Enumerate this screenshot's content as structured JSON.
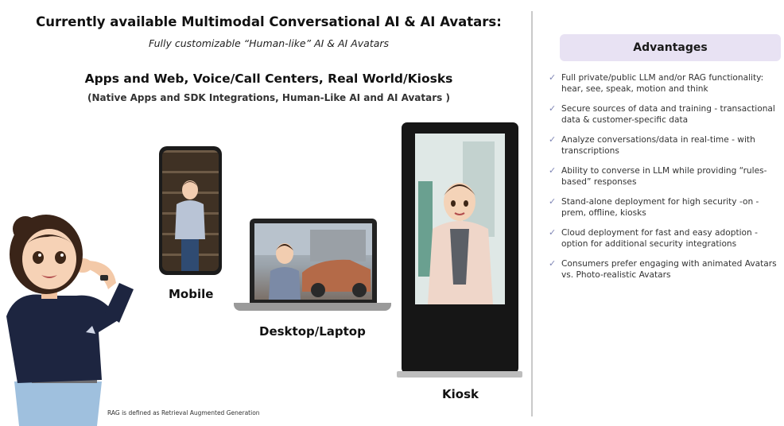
{
  "header": {
    "title": "Currently available Multimodal Conversational AI & AI Avatars:",
    "subtitle": "Fully customizable “Human-like” AI & AI Avatars",
    "apps_title": "Apps and Web, Voice/Call Centers, Real World/Kiosks",
    "apps_subtitle": "(Native Apps and SDK Integrations, Human-Like AI and AI Avatars )"
  },
  "devices": {
    "mobile_label": "Mobile",
    "desktop_label": "Desktop/Laptop",
    "kiosk_label": "Kiosk"
  },
  "footnote": "RAG is defined as Retrieval Augmented Generation",
  "advantages": {
    "title": "Advantages",
    "check_icon": "✓",
    "items": [
      "Full private/public LLM and/or RAG functionality: hear, see, speak, motion and think",
      "Secure sources of data and training - transactional data & customer-specific data",
      "Analyze conversations/data in real-time - with transcriptions",
      "Ability to converse in LLM while providing “rules-based” responses",
      "Stand-alone deployment for high security -on -prem, offline, kiosks",
      "Cloud deployment for fast and easy adoption - option for additional security integrations",
      "Consumers prefer engaging with animated Avatars vs. Photo-realistic Avatars"
    ]
  },
  "colors": {
    "advantages_header_bg": "#e8e2f3",
    "check_color": "#7f86b5",
    "divider": "#c9c9c9"
  }
}
